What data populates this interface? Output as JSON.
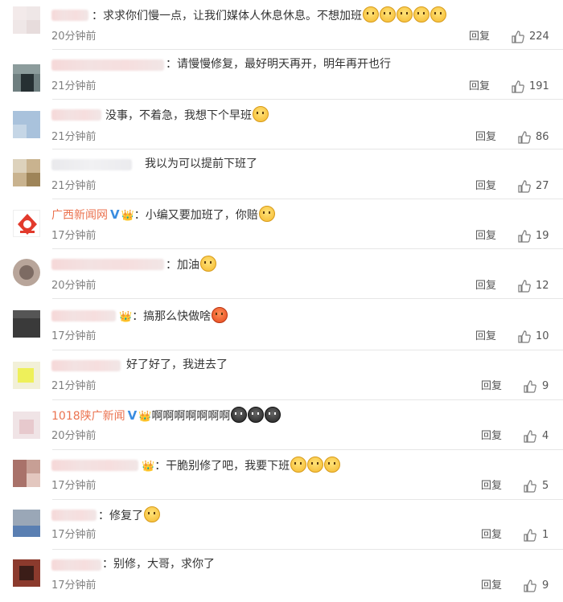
{
  "comments": [
    {
      "name": "",
      "message": "：求求你们慢一点，让我们媒体人休息休息。不想加班",
      "emojis": [
        "cry-emoji",
        "cry-emoji",
        "cry-emoji",
        "cry-emoji",
        "cry-emoji"
      ],
      "time": "20分钟前",
      "reply": "回复",
      "likes": "224"
    },
    {
      "name": "",
      "message": "：请慢慢修复，最好明天再开，明年再开也行",
      "emojis": [],
      "time": "21分钟前",
      "reply": "回复",
      "likes": "191"
    },
    {
      "name": "",
      "message": "没事，不着急，我想下个早班",
      "emojis": [
        "smile-emoji"
      ],
      "time": "21分钟前",
      "reply": "回复",
      "likes": "86"
    },
    {
      "name": "",
      "message": "我以为可以提前下班了",
      "emojis": [],
      "time": "21分钟前",
      "reply": "回复",
      "likes": "27"
    },
    {
      "name": "广西新闻网",
      "message": "：小编又要加班了，你赔",
      "emojis": [
        "cry-emoji"
      ],
      "time": "17分钟前",
      "reply": "回复",
      "likes": "19"
    },
    {
      "name": "",
      "message": "：加油",
      "emojis": [
        "cheer-emoji"
      ],
      "time": "20分钟前",
      "reply": "回复",
      "likes": "12"
    },
    {
      "name": "",
      "message": "：搞那么快做啥",
      "emojis": [
        "angry-emoji"
      ],
      "time": "17分钟前",
      "reply": "回复",
      "likes": "10"
    },
    {
      "name": "",
      "message": "好了好了，我进去了",
      "emojis": [],
      "time": "21分钟前",
      "reply": "回复",
      "likes": "9"
    },
    {
      "name": "1018陕广新闻",
      "message": "啊啊啊啊啊啊啊",
      "emojis": [
        "tear-emoji",
        "tear-emoji",
        "tear-emoji"
      ],
      "time": "20分钟前",
      "reply": "回复",
      "likes": "4"
    },
    {
      "name": "",
      "message": "：干脆别修了吧，我要下班",
      "emojis": [
        "grin-emoji",
        "grin-emoji",
        "grin-emoji"
      ],
      "time": "17分钟前",
      "reply": "回复",
      "likes": "5"
    },
    {
      "name": "",
      "message": "：修复了",
      "emojis": [
        "doge-emoji"
      ],
      "time": "17分钟前",
      "reply": "回复",
      "likes": "1"
    },
    {
      "name": "",
      "message": "：别修，大哥，求你了",
      "emojis": [],
      "time": "17分钟前",
      "reply": "回复",
      "likes": "9"
    }
  ]
}
